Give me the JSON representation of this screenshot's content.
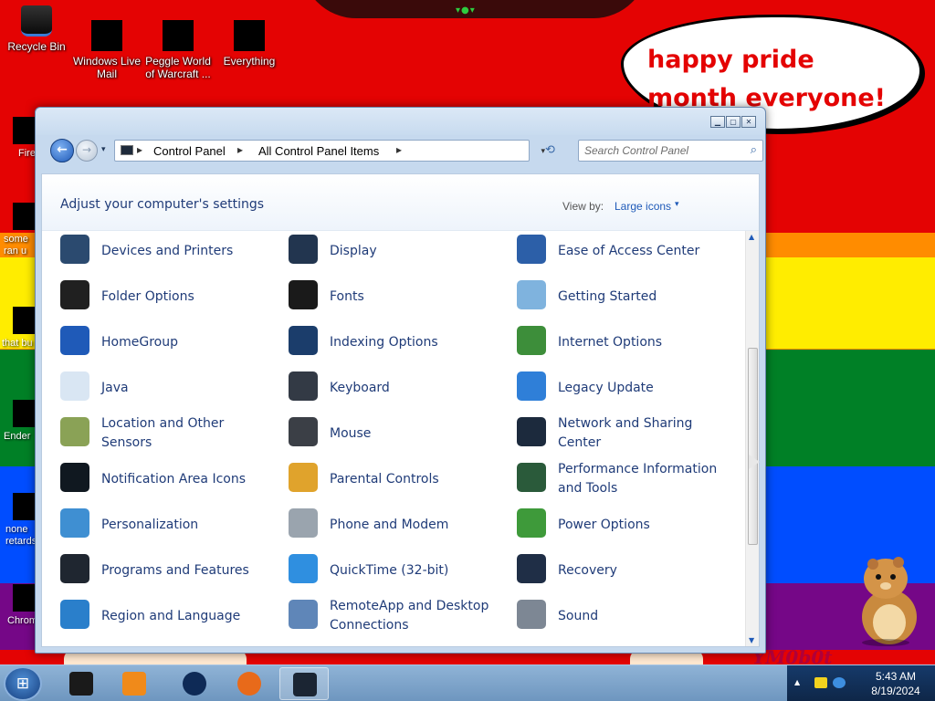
{
  "wallpaper": {
    "speech_bubble": "happy pride month everyone!",
    "watermark": "YM0b0t"
  },
  "desktop": {
    "icons": [
      {
        "label": "Recycle Bin",
        "icon": "recycle-bin-icon"
      },
      {
        "label": "Windows Live Mail",
        "icon": "windows-live-mail-icon"
      },
      {
        "label": "Peggle World of Warcraft ...",
        "icon": "peggle-icon"
      },
      {
        "label": "Everything",
        "icon": "everything-icon"
      }
    ],
    "left_icons": [
      {
        "label": "Fire",
        "icon": "firefox-shortcut-icon"
      },
      {
        "label": "some ran u",
        "icon": "shortcut-icon"
      },
      {
        "label": "that bu",
        "icon": "shortcut-icon"
      },
      {
        "label": "Ender",
        "icon": "shortcut-icon"
      },
      {
        "label": "none retards",
        "icon": "shortcut-icon"
      },
      {
        "label": "Chrom",
        "icon": "chrome-shortcut-icon"
      }
    ]
  },
  "window": {
    "title_buttons": {
      "minimize": "minimize",
      "maximize": "maximize",
      "close": "close"
    },
    "address": {
      "crumbs": [
        "Control Panel",
        "All Control Panel Items"
      ]
    },
    "search_placeholder": "Search Control Panel",
    "heading": "Adjust your computer's settings",
    "view_by_label": "View by:",
    "view_by_value": "Large icons",
    "items": [
      {
        "label": "Devices and Printers",
        "icon": "devices-printers-icon",
        "color": "#2b4a6f"
      },
      {
        "label": "Display",
        "icon": "display-icon",
        "color": "#22354f"
      },
      {
        "label": "Ease of Access Center",
        "icon": "ease-of-access-icon",
        "color": "#2c5fa8"
      },
      {
        "label": "Folder Options",
        "icon": "folder-options-icon",
        "color": "#202020"
      },
      {
        "label": "Fonts",
        "icon": "fonts-icon",
        "color": "#1a1a1a"
      },
      {
        "label": "Getting Started",
        "icon": "getting-started-icon",
        "color": "#7fb3de"
      },
      {
        "label": "HomeGroup",
        "icon": "homegroup-icon",
        "color": "#1f5ab8"
      },
      {
        "label": "Indexing Options",
        "icon": "indexing-options-icon",
        "color": "#1b3d6b"
      },
      {
        "label": "Internet Options",
        "icon": "internet-options-icon",
        "color": "#3d8e3a"
      },
      {
        "label": "Java",
        "icon": "java-icon",
        "color": "#d9e6f3"
      },
      {
        "label": "Keyboard",
        "icon": "keyboard-icon",
        "color": "#333a45"
      },
      {
        "label": "Legacy Update",
        "icon": "legacy-update-icon",
        "color": "#2f7fd8"
      },
      {
        "label": "Location and Other Sensors",
        "icon": "location-sensors-icon",
        "color": "#8aa256"
      },
      {
        "label": "Mouse",
        "icon": "mouse-icon",
        "color": "#3b3f46"
      },
      {
        "label": "Network and Sharing Center",
        "icon": "network-sharing-icon",
        "color": "#1c2a3d"
      },
      {
        "label": "Notification Area Icons",
        "icon": "notification-area-icon",
        "color": "#101820"
      },
      {
        "label": "Parental Controls",
        "icon": "parental-controls-icon",
        "color": "#e0a32c"
      },
      {
        "label": "Performance Information and Tools",
        "icon": "performance-info-icon",
        "color": "#2a5a3a"
      },
      {
        "label": "Personalization",
        "icon": "personalization-icon",
        "color": "#3f8fd2"
      },
      {
        "label": "Phone and Modem",
        "icon": "phone-modem-icon",
        "color": "#9aa4ae"
      },
      {
        "label": "Power Options",
        "icon": "power-options-icon",
        "color": "#3e9a3a"
      },
      {
        "label": "Programs and Features",
        "icon": "programs-features-icon",
        "color": "#1f2630"
      },
      {
        "label": "QuickTime (32-bit)",
        "icon": "quicktime-icon",
        "color": "#2f8fe0"
      },
      {
        "label": "Recovery",
        "icon": "recovery-icon",
        "color": "#1f2e46"
      },
      {
        "label": "Region and Language",
        "icon": "region-language-icon",
        "color": "#2a7fcb"
      },
      {
        "label": "RemoteApp and Desktop Connections",
        "icon": "remoteapp-icon",
        "color": "#5f86b8"
      },
      {
        "label": "Sound",
        "icon": "sound-icon",
        "color": "#7d8794"
      }
    ]
  },
  "taskbar": {
    "apps": [
      {
        "name": "taskbar-app-recycle",
        "icon": "black-cube-icon",
        "color": "#1a1a1a"
      },
      {
        "name": "taskbar-app-media",
        "icon": "media-player-icon",
        "color": "#f08a1a"
      },
      {
        "name": "taskbar-app-earth",
        "icon": "globe-icon",
        "color": "#0e2a56"
      },
      {
        "name": "taskbar-app-firefox",
        "icon": "firefox-icon",
        "color": "#e86a1a"
      },
      {
        "name": "taskbar-app-control-panel",
        "icon": "control-panel-icon",
        "color": "#1b2533",
        "active": true
      }
    ],
    "clock": {
      "time": "5:43 AM",
      "date": "8/19/2024"
    }
  }
}
